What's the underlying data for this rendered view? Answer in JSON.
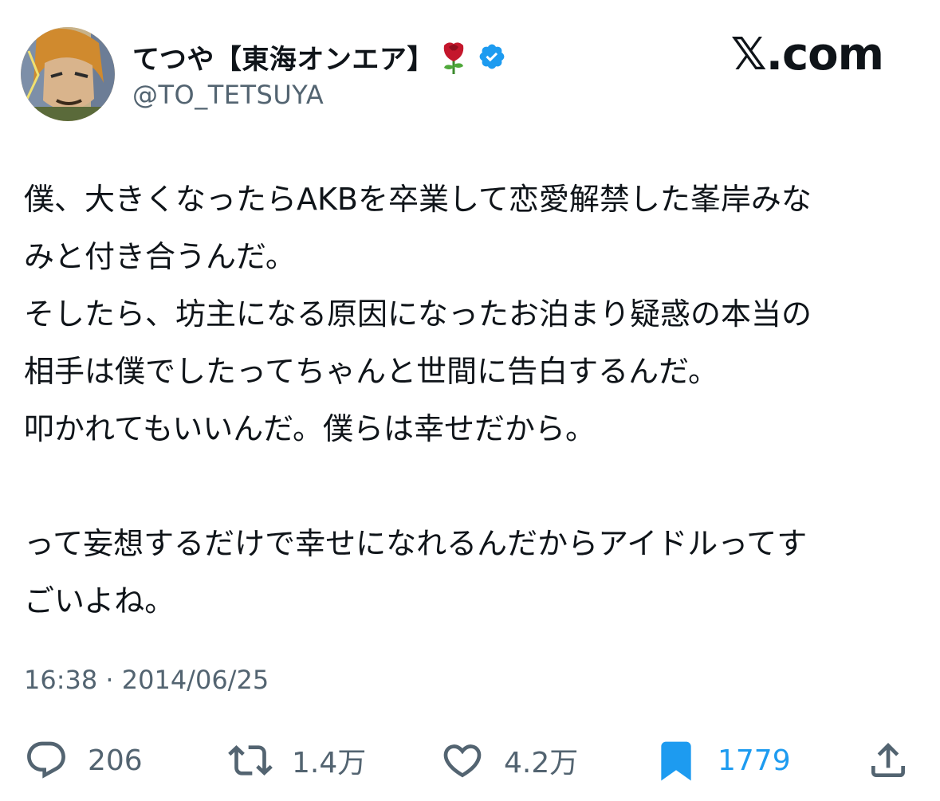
{
  "header": {
    "display_name": "てつや【東海オンエア】",
    "emoji_icon": "rose-emoji",
    "verified_icon": "verified-badge-icon",
    "handle": "@TO_TETSUYA",
    "brand": "𝕏.com"
  },
  "tweet": {
    "lines": [
      "僕、大きくなったらAKBを卒業して恋愛解禁した峯岸みな",
      "みと付き合うんだ。",
      "そしたら、坊主になる原因になったお泊まり疑惑の本当の",
      "相手は僕でしたってちゃんと世間に告白するんだ。",
      "叩かれてもいいんだ。僕らは幸せだから。",
      "",
      "って妄想するだけで幸せになれるんだからアイドルってす",
      "ごいよね。"
    ]
  },
  "timestamp": "16:38 · 2014/06/25",
  "actions": {
    "reply": {
      "icon": "reply-icon",
      "count": "206"
    },
    "repost": {
      "icon": "repost-icon",
      "count": "1.4万"
    },
    "like": {
      "icon": "heart-icon",
      "count": "4.2万"
    },
    "bookmark": {
      "icon": "bookmark-icon",
      "count": "1779",
      "active": true
    },
    "share": {
      "icon": "share-icon"
    }
  },
  "colors": {
    "text": "#0f1419",
    "secondary": "#536471",
    "accent": "#1d9bf0"
  }
}
